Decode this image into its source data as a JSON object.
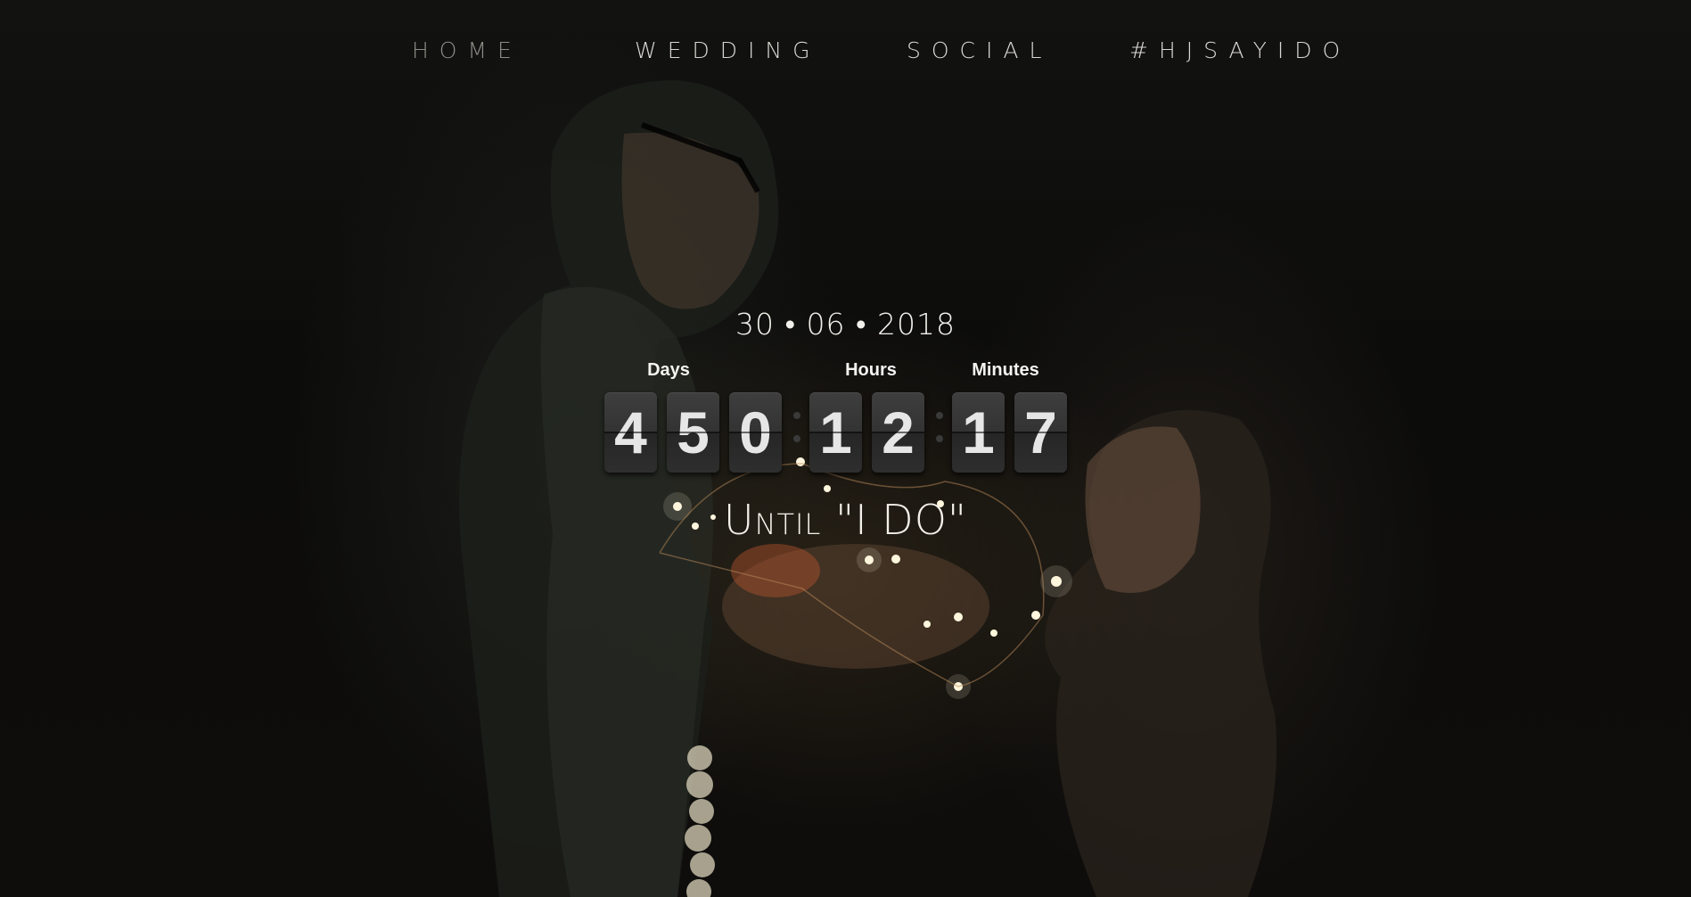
{
  "nav": {
    "items": [
      {
        "label": "HOME"
      },
      {
        "label": "WEDDING"
      },
      {
        "label": "SOCIAL"
      },
      {
        "label": "#HJSAYIDO"
      }
    ]
  },
  "hero": {
    "date": "30 • 06 • 2018",
    "labels": {
      "days": "Days",
      "hours": "Hours",
      "minutes": "Minutes"
    },
    "digits": {
      "days": [
        "4",
        "5",
        "0"
      ],
      "hours": [
        "1",
        "2"
      ],
      "minutes": [
        "1",
        "7"
      ]
    },
    "tagline": "Until \"I DO\""
  },
  "colors": {
    "background": "#0b0b0a",
    "text": "#f4f1ea",
    "nav_active": "#8f8c86",
    "flip_card": "#333333"
  }
}
